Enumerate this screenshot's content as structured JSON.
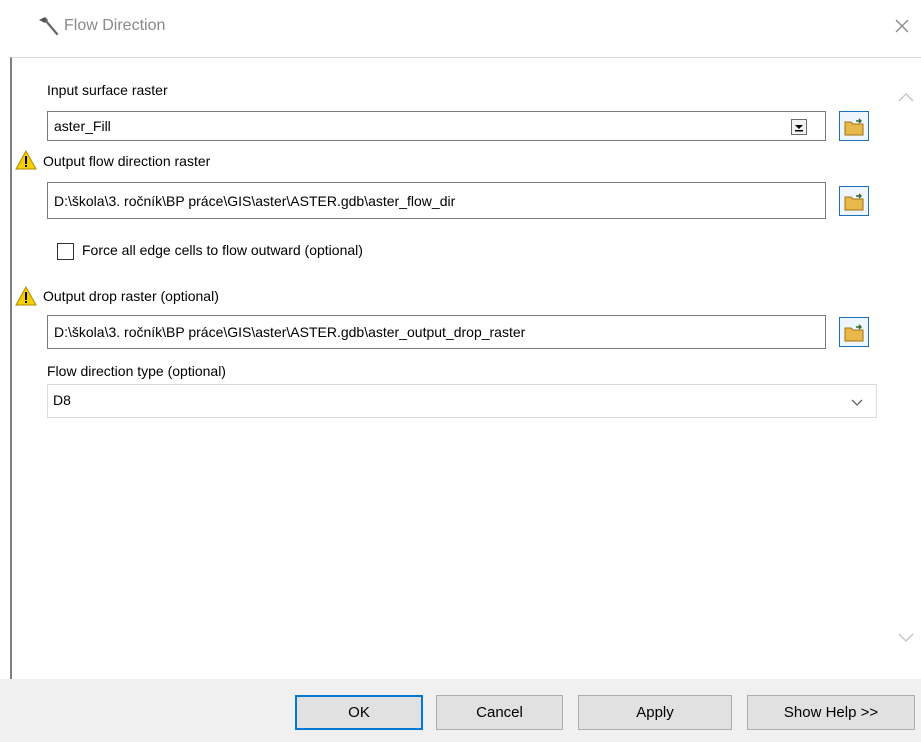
{
  "window": {
    "title": "Flow Direction",
    "title_icon": "hammer-icon",
    "close_icon": "close-icon"
  },
  "form": {
    "input_surface": {
      "label": "Input surface raster",
      "value": "aster_Fill"
    },
    "output_flow": {
      "label": "Output flow direction raster",
      "value": "D:\\škola\\3. ročník\\BP práce\\GIS\\aster\\ASTER.gdb\\aster_flow_dir"
    },
    "force_edge": {
      "label": "Force all edge cells to flow outward (optional)",
      "checked": false
    },
    "output_drop": {
      "label": "Output drop raster (optional)",
      "value": "D:\\škola\\3. ročník\\BP práce\\GIS\\aster\\ASTER.gdb\\aster_output_drop_raster"
    },
    "flow_type": {
      "label": "Flow direction type (optional)",
      "value": "D8"
    }
  },
  "buttons": {
    "ok": "OK",
    "cancel": "Cancel",
    "apply": "Apply",
    "help": "Show Help >>"
  },
  "colors": {
    "default_button_border": "#0078d7",
    "browse_border": "#1f6fbf",
    "warning": "#f5d000",
    "footer_bg": "#f0f0f0"
  }
}
